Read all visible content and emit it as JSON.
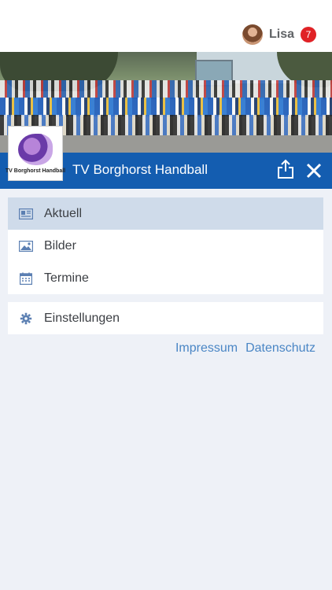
{
  "header": {
    "username": "Lisa",
    "notification_count": "7",
    "avatar_icon": "avatar"
  },
  "club": {
    "name": "TV Borghorst Handball",
    "logo_text": "TV Borghorst Handball"
  },
  "colors": {
    "brand_blue": "#145db0",
    "active_item_bg": "#cfdbea",
    "badge_red": "#e02226",
    "link_blue": "#4a86c5",
    "icon_blue": "#5b7fb2",
    "page_bg": "#eef1f7"
  },
  "menu": {
    "items": [
      {
        "label": "Aktuell",
        "icon": "newspaper-icon",
        "active": true
      },
      {
        "label": "Bilder",
        "icon": "image-icon",
        "active": false
      },
      {
        "label": "Termine",
        "icon": "calendar-icon",
        "active": false
      }
    ],
    "settings": {
      "label": "Einstellungen",
      "icon": "gear-icon"
    }
  },
  "footer_links": {
    "impressum": "Impressum",
    "datenschutz": "Datenschutz"
  }
}
